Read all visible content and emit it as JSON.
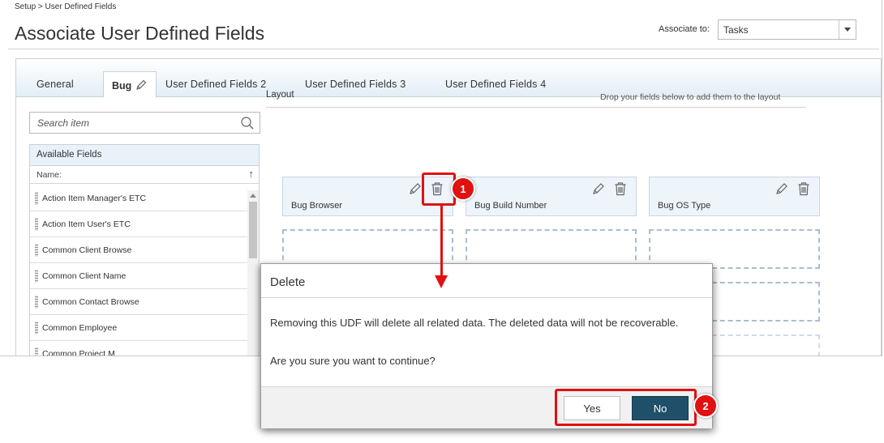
{
  "breadcrumb": "Setup > User Defined Fields",
  "page_title": "Associate User Defined Fields",
  "associate": {
    "label": "Associate to:",
    "value": "Tasks"
  },
  "tabs": [
    {
      "label": "General"
    },
    {
      "label": "Bug"
    },
    {
      "label": "User Defined Fields 2"
    },
    {
      "label": "User Defined Fields 3"
    },
    {
      "label": "User Defined Fields 4"
    }
  ],
  "search": {
    "placeholder": "Search item"
  },
  "available_fields": {
    "title": "Available Fields",
    "column": "Name:",
    "items": [
      "Action Item Manager's ETC",
      "Action Item User's ETC",
      "Common Client Browse",
      "Common Client Name",
      "Common Contact Browse",
      "Common Employee",
      "Common Project M..."
    ]
  },
  "layout": {
    "label": "Layout",
    "hint": "Drop your fields below to add them to the layout",
    "cards": [
      "Bug Browser",
      "Bug Build Number",
      "Bug OS Type"
    ]
  },
  "dialog": {
    "title": "Delete",
    "message": "Removing this UDF will delete all related data. The deleted data will not be recoverable.",
    "question": "Are you sure you want to continue?",
    "yes": "Yes",
    "no": "No"
  },
  "annotations": {
    "step1": "1",
    "step2": "2",
    "color": "#e01111"
  },
  "colors": {
    "accent": "#1f4f69",
    "tab_gradient_end": "#e3eef7",
    "card_bg": "#edf4fa"
  }
}
